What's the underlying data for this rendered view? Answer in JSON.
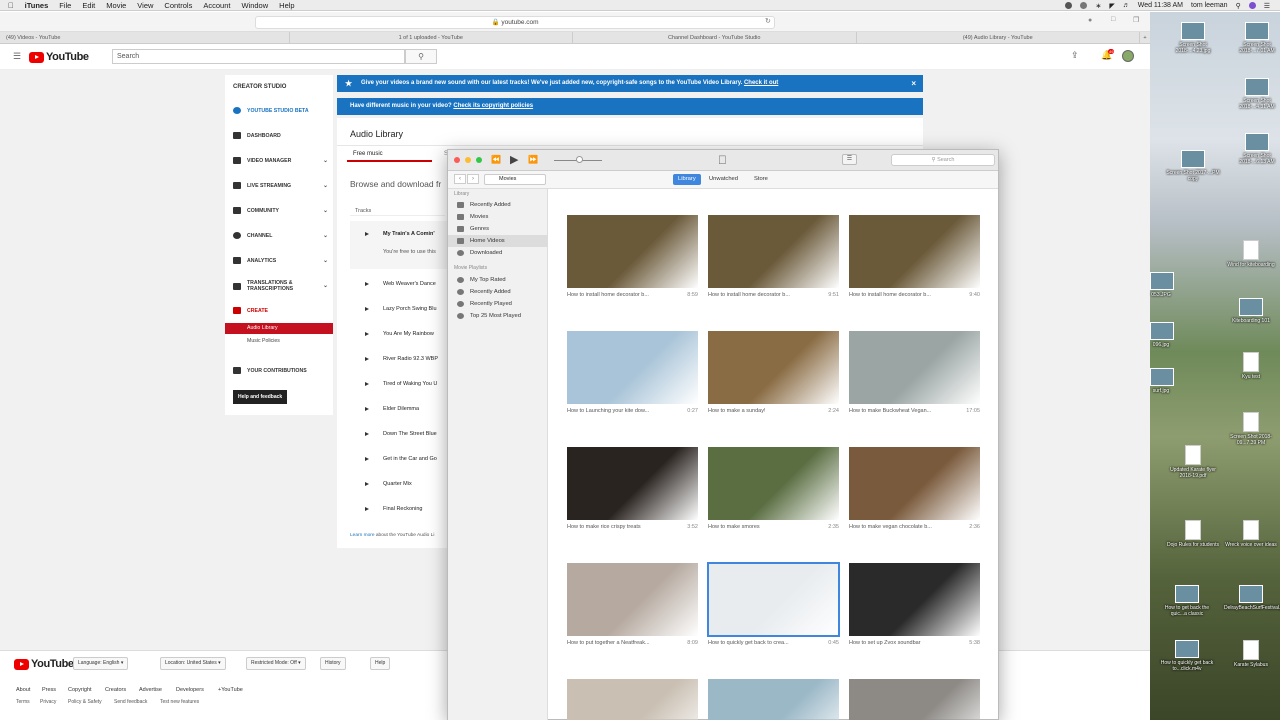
{
  "menubar": {
    "app": "iTunes",
    "items": [
      "File",
      "Edit",
      "Movie",
      "View",
      "Controls",
      "Account",
      "Window",
      "Help"
    ],
    "clock": "Wed 11:38 AM",
    "user": "tom leeman"
  },
  "browser": {
    "url": "youtube.com",
    "tabs": [
      "(49) Videos - YouTube",
      "1 of 1 uploaded - YouTube",
      "Channel Dashboard - YouTube Studio",
      "(49) Audio Library - YouTube"
    ]
  },
  "youtube": {
    "logo": "YouTube",
    "search_placeholder": "Search",
    "notif_count": "49",
    "sidebar": {
      "title": "CREATOR STUDIO",
      "items": [
        {
          "label": "YOUTUBE STUDIO BETA",
          "chev": ""
        },
        {
          "label": "DASHBOARD",
          "chev": ""
        },
        {
          "label": "VIDEO MANAGER",
          "chev": "⌄"
        },
        {
          "label": "LIVE STREAMING",
          "chev": "⌄"
        },
        {
          "label": "COMMUNITY",
          "chev": "⌄"
        },
        {
          "label": "CHANNEL",
          "chev": "⌄"
        },
        {
          "label": "ANALYTICS",
          "chev": "⌄"
        },
        {
          "label": "TRANSLATIONS & TRANSCRIPTIONS",
          "chev": "⌄"
        },
        {
          "label": "CREATE",
          "chev": ""
        },
        {
          "label": "YOUR CONTRIBUTIONS",
          "chev": ""
        }
      ],
      "sub_active": "Audio Library",
      "sub_other": "Music Policies",
      "help_button": "Help and feedback"
    },
    "banner1": {
      "text": "Give your videos a brand new sound with our latest tracks! We've just added new, copyright-safe songs to the YouTube Video Library.",
      "link": "Check it out"
    },
    "banner2": {
      "text": "Have different music in your video?",
      "link": "Check its copyright policies"
    },
    "audio_library": {
      "title": "Audio Library",
      "tab_free": "Free music",
      "tab_other": "S",
      "browse": "Browse and download fr",
      "tracks_header": "Tracks",
      "expanded_sub": "You're free to use this",
      "tracks": [
        "My Train's A Comin'",
        "Web Weaver's Dance",
        "Lazy Porch Swing Blu",
        "You Are My Rainbow",
        "River Radio 92.3 WBP",
        "Tired of Waking You U",
        "Elder Dilemma",
        "Down The Street Blue",
        "Get in the Car and Go",
        "Quarter Mix",
        "Final Reckoning"
      ],
      "learn_more_link": "Learn more",
      "learn_more_rest": "about the YouTube Audio Li"
    },
    "footer": {
      "buttons": [
        "Language: English ▾",
        "Location: United States ▾",
        "Restricted Mode: Off ▾",
        "History",
        "Help"
      ],
      "links1": [
        "About",
        "Press",
        "Copyright",
        "Creators",
        "Advertise",
        "Developers",
        "+YouTube"
      ],
      "links2": [
        "Terms",
        "Privacy",
        "Policy & Safety",
        "Send feedback",
        "Test new features"
      ]
    }
  },
  "itunes": {
    "search_placeholder": "Search",
    "media_select": "Movies",
    "segments": [
      "Library",
      "Unwatched",
      "Store"
    ],
    "sidebar": {
      "library_header": "Library",
      "library_items": [
        "Recently Added",
        "Movies",
        "Genres",
        "Home Videos",
        "Downloaded"
      ],
      "playlists_header": "Movie Playlists",
      "playlist_items": [
        "My Top Rated",
        "Recently Added",
        "Recently Played",
        "Top 25 Most Played"
      ]
    },
    "videos": [
      {
        "title": "How to install home decorator b...",
        "dur": "8:59",
        "color": "#6b5a3a"
      },
      {
        "title": "How to install home decorator b...",
        "dur": "9:51",
        "color": "#6b5a3a"
      },
      {
        "title": "How to install home decorator b...",
        "dur": "9:40",
        "color": "#6b5a3a"
      },
      {
        "title": "How to Launching your kite dow...",
        "dur": "0:27",
        "color": "#a9c4d8"
      },
      {
        "title": "How to make a sunday!",
        "dur": "2:24",
        "color": "#8a6c44"
      },
      {
        "title": "How to make Buckwheat Vegan...",
        "dur": "17:05",
        "color": "#9aa5a4"
      },
      {
        "title": "How to make rice crispy treats",
        "dur": "3:52",
        "color": "#2a2420"
      },
      {
        "title": "How to make smores",
        "dur": "2:35",
        "color": "#5a6e42"
      },
      {
        "title": "How to make vegan chocolate b...",
        "dur": "2:36",
        "color": "#7a5a3c"
      },
      {
        "title": "How to put together a Neatfreak...",
        "dur": "8:09",
        "color": "#b6aaa0"
      },
      {
        "title": "How to quickly get back to crea...",
        "dur": "0:45",
        "color": "#e8ecef"
      },
      {
        "title": "How to set up Zvox soundbar",
        "dur": "5:38",
        "color": "#2a2a2a"
      },
      {
        "title": "",
        "dur": "",
        "color": "#c9bfb2"
      },
      {
        "title": "",
        "dur": "",
        "color": "#9bb8c7"
      },
      {
        "title": "",
        "dur": "",
        "color": "#8d8a86"
      }
    ]
  },
  "desktop": {
    "icons": [
      {
        "label": "Screen Shot 2018-...4.23.jpg",
        "type": "img"
      },
      {
        "label": "Screen Shot 2018-...7.01 AM",
        "type": "img"
      },
      {
        "label": "Screen Shot 2018-...4.31 AM",
        "type": "img"
      },
      {
        "label": "Screen Shot 2017-...PM copy",
        "type": "img"
      },
      {
        "label": "Screen Shot 2018-...6.13 AM",
        "type": "img"
      },
      {
        "label": "Wind for kiteboarding",
        "type": "doc"
      },
      {
        "label": "Kiteboarding 101",
        "type": "img"
      },
      {
        "label": "Kyu test",
        "type": "doc"
      },
      {
        "label": "Screen Shot 2018-09...7.39 PM",
        "type": "doc"
      },
      {
        "label": "Updated Karate flyer 2018-19.pdf",
        "type": "doc"
      },
      {
        "label": "Dojo Rules for students",
        "type": "doc"
      },
      {
        "label": "Wreck voice over ideas",
        "type": "doc"
      },
      {
        "label": "How to get back the quic...a classic",
        "type": "img"
      },
      {
        "label": "DelrayBeachSurfFestival.jpg",
        "type": "img"
      },
      {
        "label": "How to quickly get back to...click.m4v",
        "type": "img"
      },
      {
        "label": "Karate Sylabus",
        "type": "doc"
      },
      {
        "label": "053.JPG",
        "type": "img"
      },
      {
        "label": "096.jpg",
        "type": "img"
      },
      {
        "label": "surf.jpg",
        "type": "img"
      }
    ]
  }
}
